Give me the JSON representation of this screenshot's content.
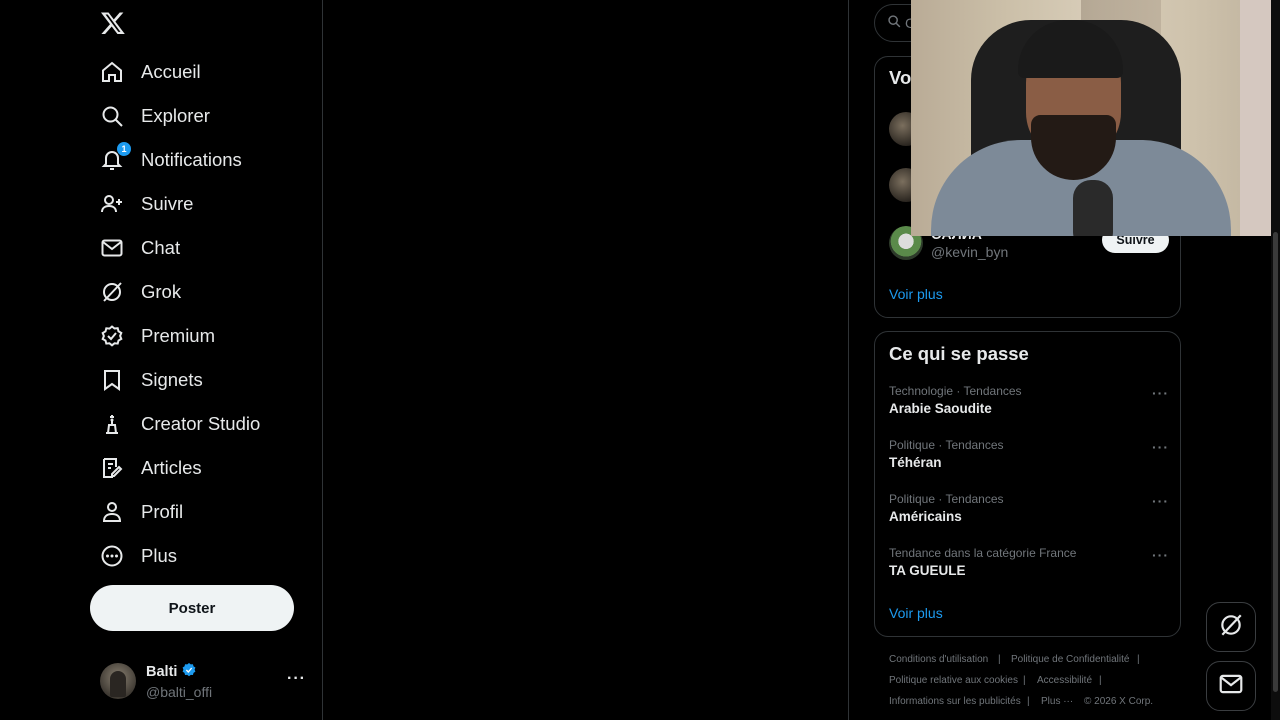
{
  "nav": {
    "items": [
      {
        "label": "Accueil",
        "icon": "home-icon"
      },
      {
        "label": "Explorer",
        "icon": "search-icon"
      },
      {
        "label": "Notifications",
        "icon": "bell-icon",
        "badge": "1"
      },
      {
        "label": "Suivre",
        "icon": "follow-icon"
      },
      {
        "label": "Chat",
        "icon": "mail-icon"
      },
      {
        "label": "Grok",
        "icon": "grok-icon"
      },
      {
        "label": "Premium",
        "icon": "premium-icon"
      },
      {
        "label": "Signets",
        "icon": "bookmark-icon"
      },
      {
        "label": "Creator Studio",
        "icon": "creator-studio-icon"
      },
      {
        "label": "Articles",
        "icon": "articles-icon"
      },
      {
        "label": "Profil",
        "icon": "profile-icon"
      },
      {
        "label": "Plus",
        "icon": "more-circle-icon"
      }
    ],
    "post_label": "Poster"
  },
  "account": {
    "name": "Balti",
    "handle": "@balti_offi",
    "more": "···"
  },
  "search": {
    "placeholder": "C"
  },
  "who_to_follow": {
    "title": "Vo",
    "rows": [
      {
        "name": "",
        "handle": ""
      },
      {
        "name": "",
        "handle": ""
      },
      {
        "name": "ОАЛИА",
        "handle": "@kevin_byn",
        "button": "Suivre"
      }
    ],
    "see_more": "Voir plus"
  },
  "trends": {
    "title": "Ce qui se passe",
    "items": [
      {
        "category": "Technologie · Tendances",
        "name": "Arabie Saoudite"
      },
      {
        "category": "Politique · Tendances",
        "name": "Téhéran"
      },
      {
        "category": "Politique · Tendances",
        "name": "Américains"
      },
      {
        "category": "Tendance dans la catégorie France",
        "name": "TA GUEULE"
      }
    ],
    "more": "···",
    "see_more": "Voir plus"
  },
  "footer": {
    "links": [
      "Conditions d'utilisation",
      "Politique de Confidentialité",
      "Politique relative aux cookies",
      "Accessibilité",
      "Informations sur les publicités",
      "Plus ···",
      "© 2026 X Corp."
    ]
  },
  "colors": {
    "background": "#000000",
    "text": "#e7e9ea",
    "muted": "#71767b",
    "accent": "#1d9bf0",
    "border": "#2f3336"
  }
}
